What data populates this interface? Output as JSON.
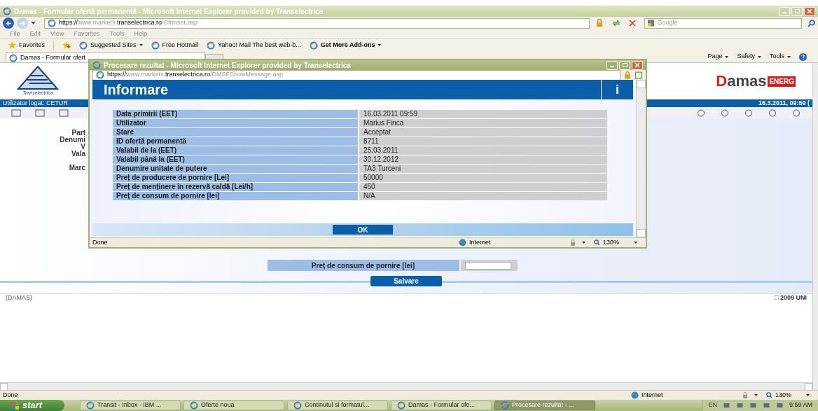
{
  "browser": {
    "title": "Damas - Formular ofertă permanentă - Microsoft Internet Explorer provided by Transelectrica",
    "address": {
      "scheme": "https://",
      "prefix": "www.markets.",
      "host": "transelectrica.ro",
      "path": "/Cfrmset.asp"
    },
    "search_placeholder": "Google",
    "menu": [
      "File",
      "Edit",
      "View",
      "Favorites",
      "Tools",
      "Help"
    ],
    "favorites_label": "Favorites",
    "favorites": [
      {
        "label": "Suggested Sites",
        "dropdown": true,
        "bold": false
      },
      {
        "label": "Free Hotmail",
        "dropdown": false,
        "bold": false
      },
      {
        "label": "Yahoo! Mail The best web-b...",
        "dropdown": false,
        "bold": false
      },
      {
        "label": "Get More Add-ons",
        "dropdown": true,
        "bold": true
      }
    ],
    "tab": {
      "label": "Damas - Formular ofert",
      "selected": true
    },
    "commands": [
      "Page",
      "Safety",
      "Tools"
    ]
  },
  "page": {
    "logo_caption": "Transelectrica",
    "brand": "Damas",
    "brand_tag": "ENERG",
    "user": "Utilizator logat: CETUR",
    "datetime": "16.3.2011, 09:59 (",
    "form_labels": [
      "Part",
      "Denumi",
      "V",
      "Vala",
      "Marc"
    ],
    "field_label": "Preț de consum de pornire [lei]",
    "save": "Salvare",
    "footer_left": "(DAMAS)",
    "footer_right": "□ 2009 UNI"
  },
  "status": {
    "text": "Done",
    "zone": "Internet",
    "zoom": "130%"
  },
  "popup": {
    "title": "Procesare rezultat - Microsoft Internet Explorer provided by Transelectrica",
    "address": {
      "scheme": "https://",
      "prefix": "www.markets.",
      "host": "transelectrica.ro",
      "path": "/DMSFShowMessage.asp"
    },
    "heading": "Informare",
    "info_glyph": "i",
    "rows": [
      {
        "label": "Data primirii (EET)",
        "value": "16.03.2011 09:59"
      },
      {
        "label": "Utilizator",
        "value": "Marius Finca"
      },
      {
        "label": "Stare",
        "value": "Acceptat"
      },
      {
        "label": "ID ofertă permanentă",
        "value": "8711"
      },
      {
        "label": "Valabil de la (EET)",
        "value": "25.03.2011"
      },
      {
        "label": "Valabil până la (EET)",
        "value": "30.12.2012"
      },
      {
        "label": "Denumire unitate de putere",
        "value": "TA3 Turceni"
      },
      {
        "label": "Preț de producere de pornire [Lei]",
        "value": "50000"
      },
      {
        "label": "Preț de menținere în rezervă caldă [Lei/h]",
        "value": "450"
      },
      {
        "label": "Preț de consum de pornire [lei]",
        "value": "N/A"
      }
    ],
    "ok": "OK",
    "status": {
      "text": "Done",
      "zone": "Internet",
      "zoom": "130%"
    }
  },
  "taskbar": {
    "start": "start",
    "tasks": [
      {
        "label": "Transit - Inbox - IBM ...",
        "selected": false
      },
      {
        "label": "Oferte noua",
        "selected": false
      },
      {
        "label": "Continutul si formatul...",
        "selected": false
      },
      {
        "label": "Damas - Formular ofe...",
        "selected": false
      },
      {
        "label": "Procesare rezultat - ...",
        "selected": true
      }
    ],
    "lang": "EN",
    "clock": "9:59 AM"
  }
}
